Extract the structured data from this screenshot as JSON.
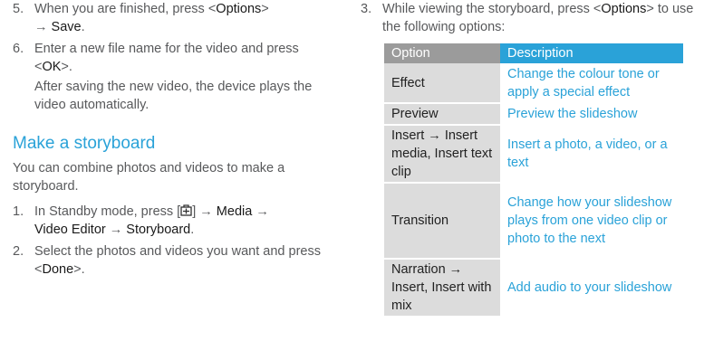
{
  "left": {
    "step5": {
      "num": "5.",
      "pre": "When you are finished, press <",
      "key": "Options",
      "post": ">",
      "arrow": "→ ",
      "action": "Save",
      "end": "."
    },
    "step6": {
      "num": "6.",
      "pre": "Enter a new file name for the video and press <",
      "key": "OK",
      "post": ">.",
      "note": "After saving the new video, the device plays the video automatically."
    },
    "heading": "Make a storyboard",
    "intro": "You can combine photos and videos to make a storyboard.",
    "step1": {
      "num": "1.",
      "pre": "In Standby mode, press [",
      "icon": "menu-key-icon",
      "mid": "] → ",
      "media": "Media",
      "arrow1": " → ",
      "editor": "Video Editor",
      "arrow2": " → ",
      "storyboard": "Storyboard",
      "end": "."
    },
    "step2": {
      "num": "2.",
      "pre": "Select the photos and videos you want and press <",
      "key": "Done",
      "post": ">."
    }
  },
  "right": {
    "step3": {
      "num": "3.",
      "pre": "While viewing the storyboard, press <",
      "key": "Options",
      "post": "> to use the following options:"
    },
    "table": {
      "headers": [
        "Option",
        "Description"
      ],
      "rows": [
        {
          "option": "Effect",
          "description": "Change the colour tone or apply a special effect"
        },
        {
          "option": "Preview",
          "description": "Preview the slideshow"
        },
        {
          "option": "Insert → Insert media, Insert text clip",
          "description": "Insert a photo, a video, or a text"
        },
        {
          "option": "Transition",
          "description": "Change how your slideshow plays from one video clip or photo to the next"
        },
        {
          "option": "Narration → Insert, Insert with mix",
          "description": "Add audio to your slideshow"
        }
      ]
    }
  },
  "colors": {
    "accent": "#2aa2d8",
    "header_grey": "#9b9b9b",
    "cell_grey": "#dcdcdc",
    "text": "#58595b"
  }
}
